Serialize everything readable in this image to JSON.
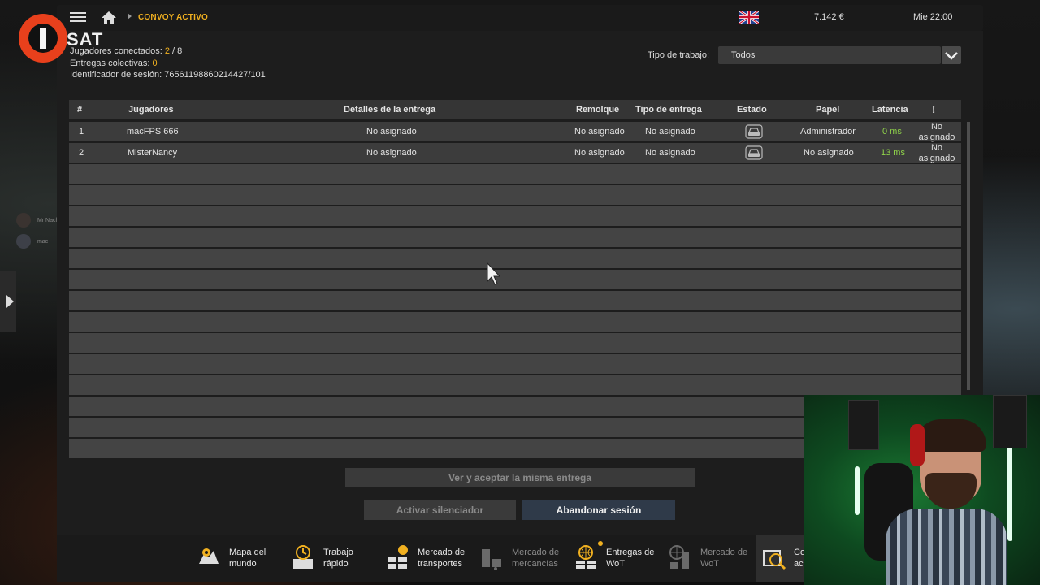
{
  "topbar": {
    "breadcrumb": "CONVOY ACTIVO",
    "money": "7.142 €",
    "clock": "Mie 22:00",
    "language_flag": "uk-flag-icon"
  },
  "branding": {
    "logo_text": "SAT"
  },
  "session_info": {
    "players_label": "Jugadores conectados:",
    "players_current": "2",
    "players_sep": " / 8",
    "deliveries_label": "Entregas colectivas:",
    "deliveries_value": "0",
    "session_id_label": "Identificador de sesión:",
    "session_id_value": "76561198860214427/101"
  },
  "filter": {
    "label": "Tipo de trabajo:",
    "value": "Todos"
  },
  "table": {
    "headers": {
      "num": "#",
      "players": "Jugadores",
      "details": "Detalles de la entrega",
      "trailer": "Remolque",
      "delivery_type": "Tipo de entrega",
      "status": "Estado",
      "role": "Papel",
      "latency": "Latencia",
      "alert": "!"
    },
    "rows": [
      {
        "num": "1",
        "player": "macFPS  666",
        "details": "No asignado",
        "trailer": "No asignado",
        "delivery_type": "No asignado",
        "role": "Administrador",
        "latency": "0 ms",
        "alert_1": "No",
        "alert_2": "asignado"
      },
      {
        "num": "2",
        "player": "MisterNancy",
        "details": "No asignado",
        "trailer": "No asignado",
        "delivery_type": "No asignado",
        "role": "No asignado",
        "latency": "13 ms",
        "alert_1": "No",
        "alert_2": "asignado"
      }
    ]
  },
  "buttons": {
    "accept_same": "Ver y aceptar la misma entrega",
    "mute": "Activar silenciador",
    "leave": "Abandonar sesión"
  },
  "bottom_nav": [
    {
      "l1": "Mapa del",
      "l2": "mundo",
      "icon": "world-map-icon"
    },
    {
      "l1": "Trabajo",
      "l2": "rápido",
      "icon": "quick-job-icon"
    },
    {
      "l1": "Mercado de",
      "l2": "transportes",
      "icon": "transport-market-icon"
    },
    {
      "l1": "Mercado de",
      "l2": "mercancías",
      "icon": "cargo-market-icon"
    },
    {
      "l1": "Entregas de",
      "l2": "WoT",
      "icon": "wot-deliveries-icon"
    },
    {
      "l1": "Mercado de",
      "l2": "WoT",
      "icon": "wot-market-icon"
    },
    {
      "l1": "Co",
      "l2": "ac",
      "icon": "convoy-icon"
    }
  ],
  "friends": [
    {
      "name": "Mr Nachota"
    },
    {
      "name": "mac",
      "extra": "666"
    }
  ],
  "colors": {
    "accent": "#f0b020",
    "latency_good": "#8fd24a",
    "primary_button": "#2f3a49"
  }
}
